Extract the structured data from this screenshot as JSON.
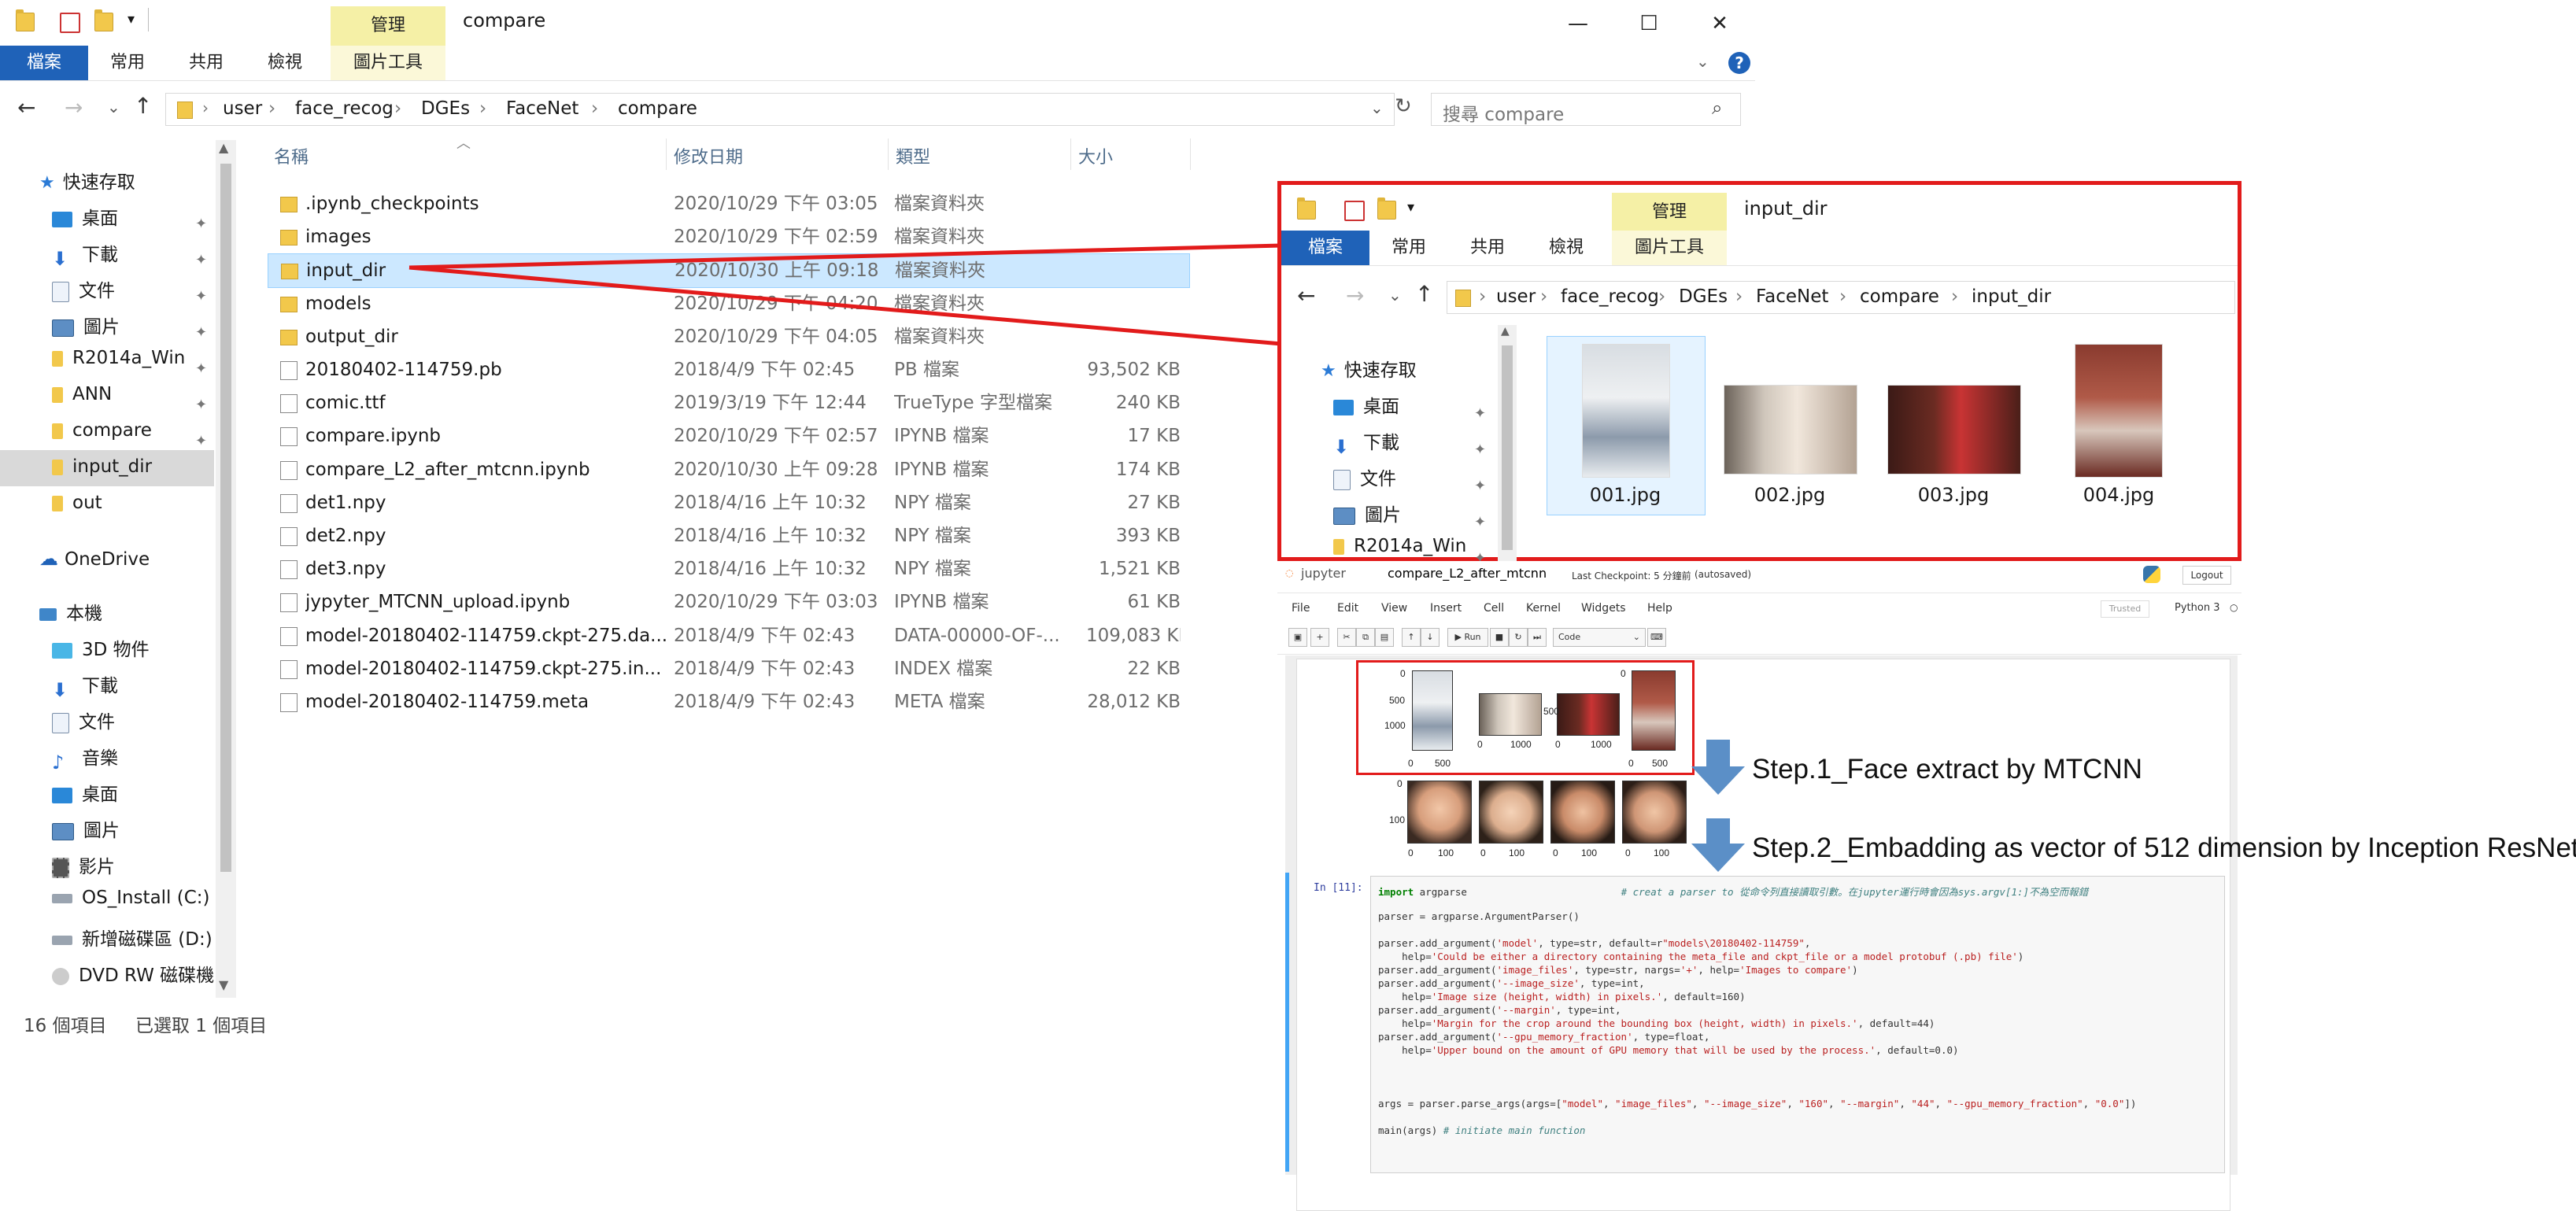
{
  "window": {
    "title": "compare",
    "manage_tab": "管理",
    "picture_tools": "圖片工具",
    "tabs": [
      "檔案",
      "常用",
      "共用",
      "檢視"
    ],
    "help": "?"
  },
  "address": {
    "crumbs": [
      "user",
      "face_recog",
      "DGEs",
      "FaceNet",
      "compare"
    ],
    "search_placeholder": "搜尋 compare"
  },
  "sidebar": {
    "quick_access": "快速存取",
    "quick_items": [
      "桌面",
      "下載",
      "文件",
      "圖片",
      "R2014a_Win",
      "ANN",
      "compare",
      "input_dir",
      "out"
    ],
    "onedrive": "OneDrive",
    "this_pc": "本機",
    "pc_items": [
      "3D 物件",
      "下載",
      "文件",
      "音樂",
      "桌面",
      "圖片",
      "影片",
      "OS_Install (C:)",
      "新增磁碟區 (D:)",
      "DVD RW 磁碟機"
    ]
  },
  "columns": {
    "name": "名稱",
    "date": "修改日期",
    "type": "類型",
    "size": "大小"
  },
  "files": [
    {
      "name": ".ipynb_checkpoints",
      "date": "2020/10/29 下午 03:05",
      "type": "檔案資料夾",
      "size": "",
      "kind": "folder"
    },
    {
      "name": "images",
      "date": "2020/10/29 下午 02:59",
      "type": "檔案資料夾",
      "size": "",
      "kind": "folder"
    },
    {
      "name": "input_dir",
      "date": "2020/10/30 上午 09:18",
      "type": "檔案資料夾",
      "size": "",
      "kind": "folder"
    },
    {
      "name": "models",
      "date": "2020/10/29 下午 04:20",
      "type": "檔案資料夾",
      "size": "",
      "kind": "folder"
    },
    {
      "name": "output_dir",
      "date": "2020/10/29 下午 04:05",
      "type": "檔案資料夾",
      "size": "",
      "kind": "folder"
    },
    {
      "name": "20180402-114759.pb",
      "date": "2018/4/9 下午 02:45",
      "type": "PB 檔案",
      "size": "93,502 KB",
      "kind": "file"
    },
    {
      "name": "comic.ttf",
      "date": "2019/3/19 下午 12:44",
      "type": "TrueType 字型檔案",
      "size": "240 KB",
      "kind": "file"
    },
    {
      "name": "compare.ipynb",
      "date": "2020/10/29 下午 02:57",
      "type": "IPYNB 檔案",
      "size": "17 KB",
      "kind": "file"
    },
    {
      "name": "compare_L2_after_mtcnn.ipynb",
      "date": "2020/10/30 上午 09:28",
      "type": "IPYNB 檔案",
      "size": "174 KB",
      "kind": "file"
    },
    {
      "name": "det1.npy",
      "date": "2018/4/16 上午 10:32",
      "type": "NPY 檔案",
      "size": "27 KB",
      "kind": "file"
    },
    {
      "name": "det2.npy",
      "date": "2018/4/16 上午 10:32",
      "type": "NPY 檔案",
      "size": "393 KB",
      "kind": "file"
    },
    {
      "name": "det3.npy",
      "date": "2018/4/16 上午 10:32",
      "type": "NPY 檔案",
      "size": "1,521 KB",
      "kind": "file"
    },
    {
      "name": "jypyter_MTCNN_upload.ipynb",
      "date": "2020/10/29 下午 03:03",
      "type": "IPYNB 檔案",
      "size": "61 KB",
      "kind": "file"
    },
    {
      "name": "model-20180402-114759.ckpt-275.da...",
      "date": "2018/4/9 下午 02:43",
      "type": "DATA-00000-OF-...",
      "size": "109,083 KB",
      "kind": "file"
    },
    {
      "name": "model-20180402-114759.ckpt-275.in...",
      "date": "2018/4/9 下午 02:43",
      "type": "INDEX 檔案",
      "size": "22 KB",
      "kind": "file"
    },
    {
      "name": "model-20180402-114759.meta",
      "date": "2018/4/9 下午 02:43",
      "type": "META 檔案",
      "size": "28,012 KB",
      "kind": "file"
    }
  ],
  "status": {
    "count": "16 個項目",
    "selected": "已選取 1 個項目"
  },
  "overlay": {
    "title": "input_dir",
    "manage_tab": "管理",
    "picture_tools": "圖片工具",
    "tabs": [
      "檔案",
      "共用",
      "檢視"
    ],
    "first_tab": "常用",
    "crumbs": [
      "user",
      "face_recog",
      "DGEs",
      "FaceNet",
      "compare",
      "input_dir"
    ],
    "quick_access": "快速存取",
    "items": [
      "桌面",
      "下載",
      "文件",
      "圖片",
      "R2014a_Win"
    ],
    "images": [
      "001.jpg",
      "002.jpg",
      "003.jpg",
      "004.jpg"
    ]
  },
  "jupyter": {
    "logo": "jupyter",
    "notebook": "compare_L2_after_mtcnn",
    "checkpoint": "Last Checkpoint: 5 分鐘前",
    "autosaved": "(autosaved)",
    "logout": "Logout",
    "trusted": "Trusted",
    "kernel": "Python 3",
    "menu": [
      "File",
      "Edit",
      "View",
      "Insert",
      "Cell",
      "Kernel",
      "Widgets",
      "Help"
    ],
    "run": "Run",
    "cell_type": "Code",
    "prompt": "In [11]:",
    "axis_ticks_1": [
      "0",
      "500",
      "1000"
    ],
    "axis_ticks_2": [
      "0",
      "100"
    ]
  },
  "steps": {
    "step1": "Step.1_Face extract by MTCNN",
    "step2": "Step.2_Embadding as vector of 512 dimension by Inception ResNet"
  },
  "colors": {
    "accent": "#1f62b8",
    "highlight": "#e21b1b",
    "arrow": "#5b8fc7",
    "selection": "#cce8ff"
  }
}
